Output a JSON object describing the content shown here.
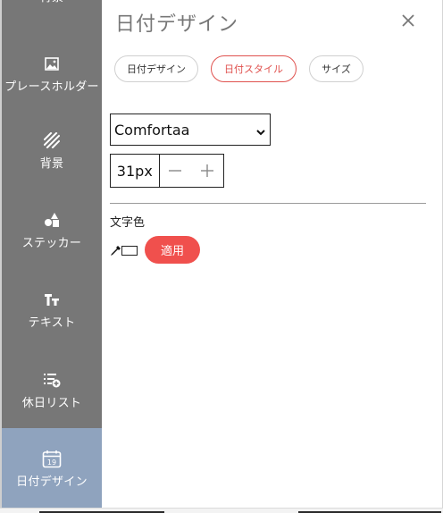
{
  "sidebar": {
    "items": [
      {
        "key": "top-cut",
        "label": "背景",
        "icon": "layout-icon",
        "active": false
      },
      {
        "key": "placeholder",
        "label": "プレースホルダー",
        "icon": "image-icon",
        "active": false
      },
      {
        "key": "background",
        "label": "背景",
        "icon": "hatch-pattern-icon",
        "active": false
      },
      {
        "key": "sticker",
        "label": "ステッカー",
        "icon": "shapes-icon",
        "active": false
      },
      {
        "key": "text",
        "label": "テキスト",
        "icon": "text-size-icon",
        "active": false
      },
      {
        "key": "holiday-list",
        "label": "休日リスト",
        "icon": "list-add-icon",
        "active": false
      },
      {
        "key": "date-design",
        "label": "日付デザイン",
        "icon": "calendar-icon",
        "calendar_day": "19",
        "active": true
      }
    ],
    "colors": {
      "background": "#777777",
      "active": "#8fa3be"
    }
  },
  "panel": {
    "title": "日付デザイン",
    "close_icon": "close-icon",
    "tabs": [
      {
        "label": "日付デザイン",
        "active": false
      },
      {
        "label": "日付スタイル",
        "active": true
      },
      {
        "label": "サイズ",
        "active": false
      }
    ],
    "font_select": {
      "value": "Comfortaa"
    },
    "font_size": {
      "value": "31px",
      "decrement": "−",
      "increment": "+"
    },
    "text_color": {
      "label": "文字色",
      "dropper_icon": "eyedropper-icon",
      "swatch_color": "#ffffff",
      "apply_label": "適用"
    },
    "accent_color": "#f0504d"
  }
}
